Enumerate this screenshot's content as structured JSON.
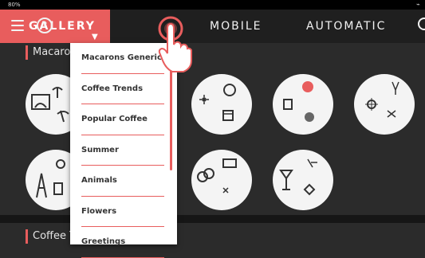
{
  "status": {
    "battery": "80%",
    "signal_icon": "signal-icon"
  },
  "tabs": [
    {
      "label": "GALLERY",
      "active": true
    },
    {
      "label": "MOBILE"
    },
    {
      "label": "AUTOMATIC"
    }
  ],
  "sections": [
    {
      "title": "Macarons"
    },
    {
      "title": "Coffee T"
    }
  ],
  "dropdown": {
    "items": [
      "Macarons Generic",
      "Coffee Trends",
      "Popular Coffee",
      "Summer",
      "Animals",
      "Flowers",
      "Greetings"
    ]
  },
  "colors": {
    "accent": "#e85d5d",
    "background": "#2b2b2b",
    "topbar": "#1f1f1f",
    "circle": "#f4f4f4"
  }
}
